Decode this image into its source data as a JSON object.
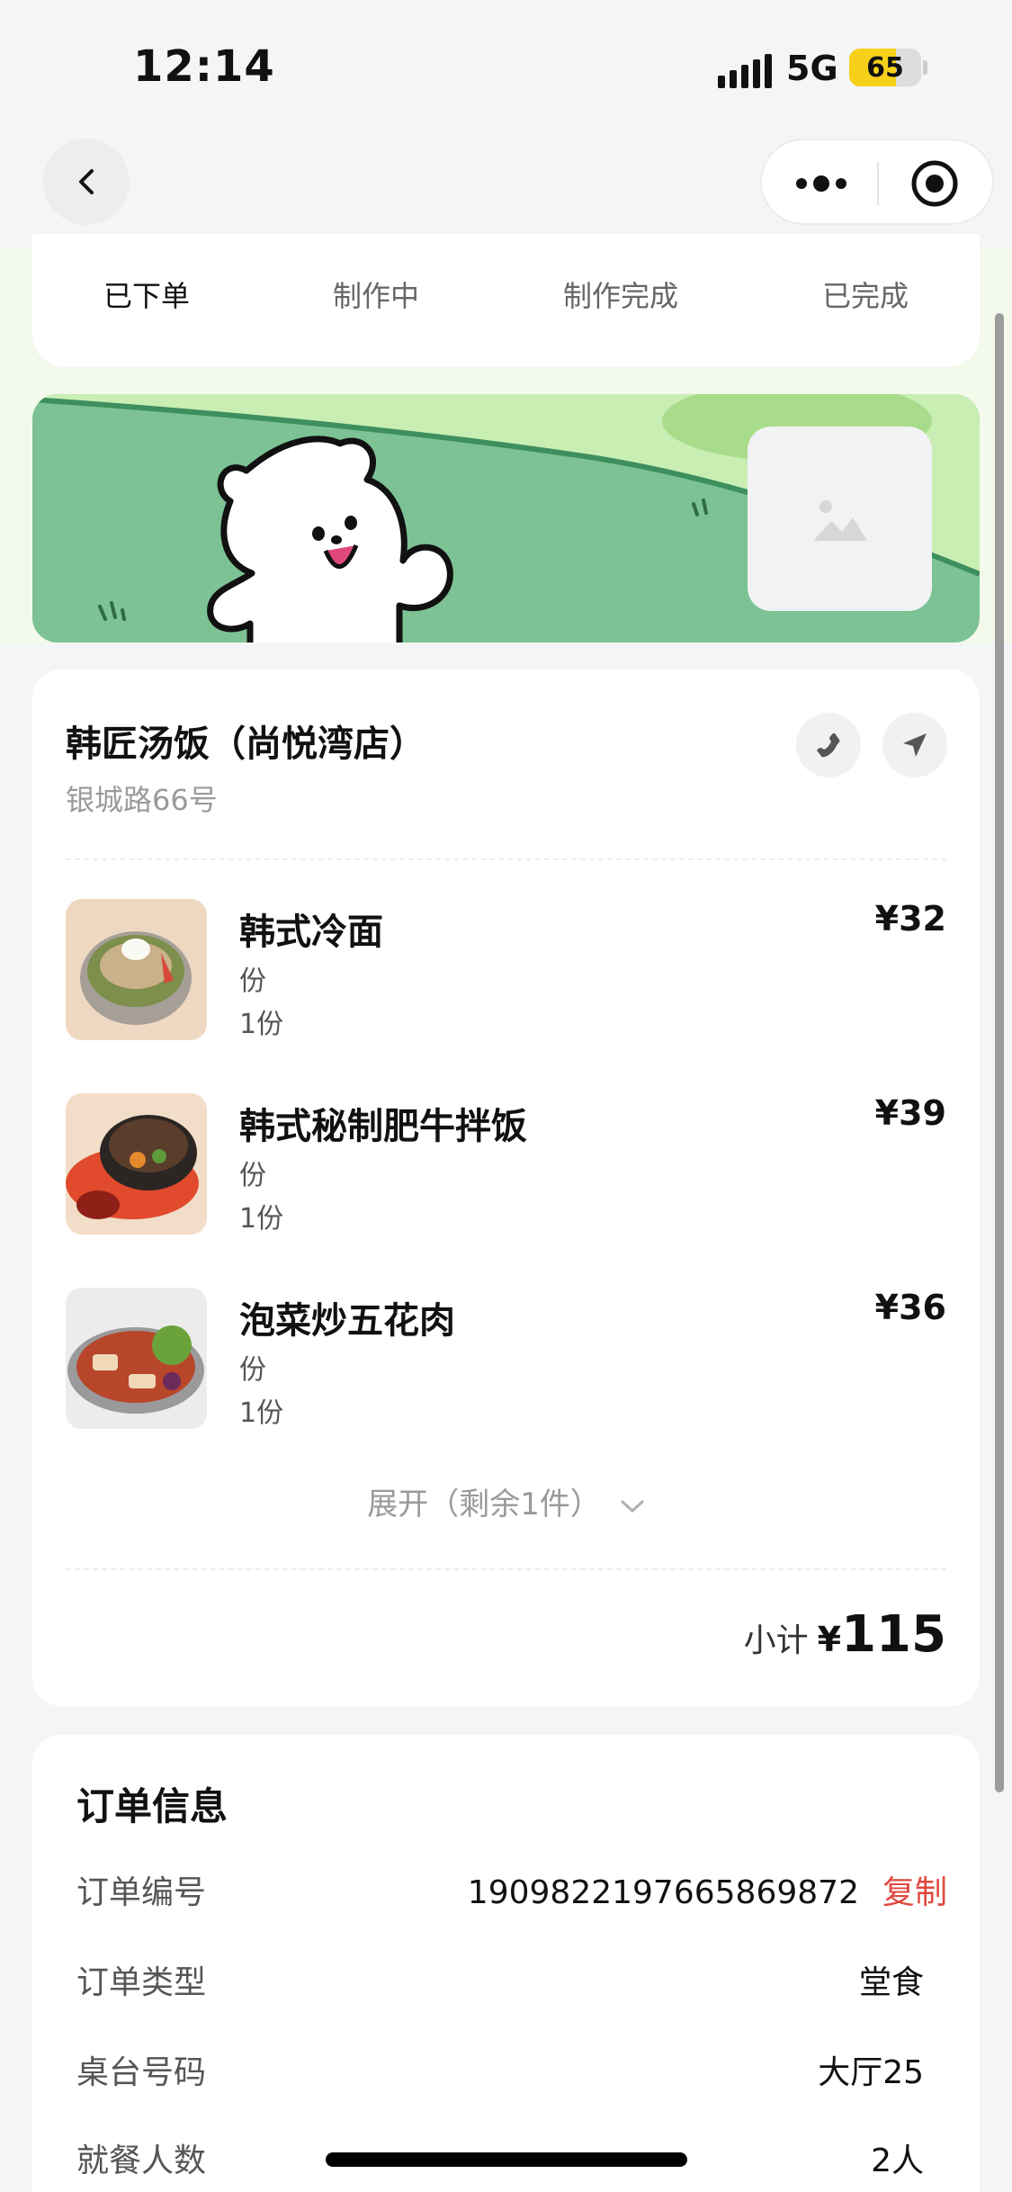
{
  "status_bar": {
    "time": "12:14",
    "network": "5G",
    "battery": "65",
    "battery_level": 0.65
  },
  "progress": {
    "steps": [
      {
        "label": "已下单"
      },
      {
        "label": "制作中"
      },
      {
        "label": "制作完成"
      },
      {
        "label": "已完成"
      }
    ],
    "current_step": 0
  },
  "shop": {
    "name": "韩匠汤饭（尚悦湾店）",
    "address": "银城路66号"
  },
  "items": [
    {
      "name": "韩式冷面",
      "spec": "份",
      "qty": "1份",
      "price": "¥32"
    },
    {
      "name": "韩式秘制肥牛拌饭",
      "spec": "份",
      "qty": "1份",
      "price": "¥39"
    },
    {
      "name": "泡菜炒五花肉",
      "spec": "份",
      "qty": "1份",
      "price": "¥36"
    }
  ],
  "expand_label": "展开（剩余1件）",
  "subtotal": {
    "label": "小计",
    "symbol": "¥",
    "value": "115"
  },
  "order_info": {
    "title": "订单信息",
    "rows": [
      {
        "label": "订单编号",
        "value": "1909822197665869872",
        "action": "复制"
      },
      {
        "label": "订单类型",
        "value": "堂食"
      },
      {
        "label": "桌台号码",
        "value": "大厅25"
      },
      {
        "label": "就餐人数",
        "value": "2人"
      }
    ]
  },
  "colors": {
    "accent_red": "#e0483f",
    "banner_green": "#7cc294",
    "battery_yellow": "#f7d01a"
  },
  "icons": [
    "back-icon",
    "more-icon",
    "target-icon",
    "phone-icon",
    "navigate-icon",
    "image-placeholder-icon",
    "chevron-down-icon"
  ]
}
